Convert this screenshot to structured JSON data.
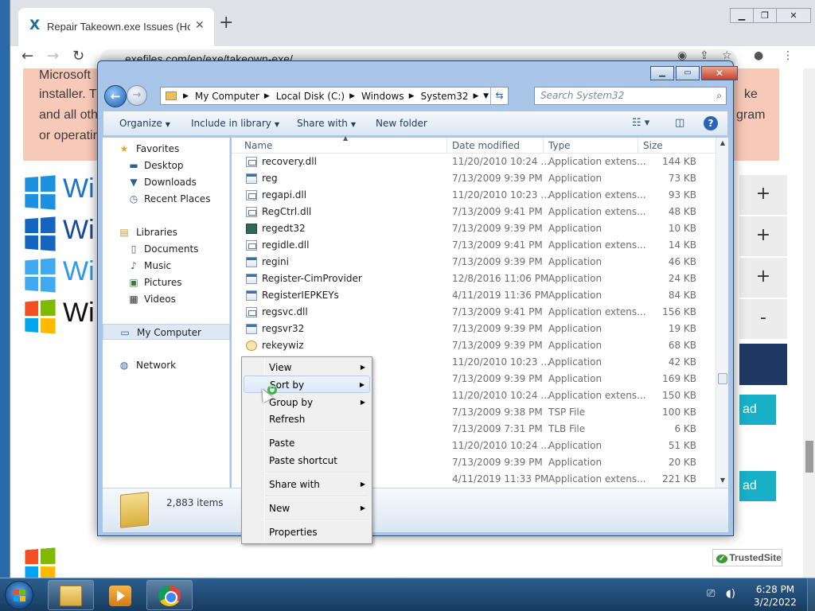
{
  "browser": {
    "tab_title": "Repair Takeown.exe Issues (How",
    "tab_close": "✕",
    "new_tab": "+",
    "url": "exefiles.com/en/exe/takeown-exe/",
    "page_lines": [
      "Microsoft",
      "installer. T",
      "and all oth",
      "or operatin"
    ],
    "right_lines": [
      "ke",
      "gram"
    ],
    "windows_label": "Wi",
    "accordion": [
      "+",
      "+",
      "+",
      "-"
    ],
    "download_label": "ad",
    "trusted_site": "TrustedSite"
  },
  "explorer": {
    "breadcrumb": [
      "My Computer",
      "Local Disk (C:)",
      "Windows",
      "System32"
    ],
    "search_placeholder": "Search System32",
    "commands": {
      "organize": "Organize",
      "include": "Include in library",
      "share": "Share with",
      "new_folder": "New folder"
    },
    "nav": {
      "favorites": "Favorites",
      "desktop": "Desktop",
      "downloads": "Downloads",
      "recent": "Recent Places",
      "libraries": "Libraries",
      "documents": "Documents",
      "music": "Music",
      "pictures": "Pictures",
      "videos": "Videos",
      "computer": "My Computer",
      "network": "Network"
    },
    "columns": [
      "Name",
      "Date modified",
      "Type",
      "Size"
    ],
    "files": [
      {
        "name": "recovery.dll",
        "date": "11/20/2010 10:24 ...",
        "type": "Application extens...",
        "size": "144 KB",
        "icon": "dll"
      },
      {
        "name": "reg",
        "date": "7/13/2009 9:39 PM",
        "type": "Application",
        "size": "73 KB",
        "icon": "app"
      },
      {
        "name": "regapi.dll",
        "date": "11/20/2010 10:23 ...",
        "type": "Application extens...",
        "size": "93 KB",
        "icon": "dll"
      },
      {
        "name": "RegCtrl.dll",
        "date": "7/13/2009 9:41 PM",
        "type": "Application extens...",
        "size": "48 KB",
        "icon": "dll"
      },
      {
        "name": "regedt32",
        "date": "7/13/2009 9:39 PM",
        "type": "Application",
        "size": "10 KB",
        "icon": "reged"
      },
      {
        "name": "regidle.dll",
        "date": "7/13/2009 9:41 PM",
        "type": "Application extens...",
        "size": "14 KB",
        "icon": "dll"
      },
      {
        "name": "regini",
        "date": "7/13/2009 9:39 PM",
        "type": "Application",
        "size": "46 KB",
        "icon": "app"
      },
      {
        "name": "Register-CimProvider",
        "date": "12/8/2016 11:06 PM",
        "type": "Application",
        "size": "24 KB",
        "icon": "app"
      },
      {
        "name": "RegisterIEPKEYs",
        "date": "4/11/2019 11:36 PM",
        "type": "Application",
        "size": "84 KB",
        "icon": "app"
      },
      {
        "name": "regsvc.dll",
        "date": "7/13/2009 9:41 PM",
        "type": "Application extens...",
        "size": "156 KB",
        "icon": "dll"
      },
      {
        "name": "regsvr32",
        "date": "7/13/2009 9:39 PM",
        "type": "Application",
        "size": "19 KB",
        "icon": "app"
      },
      {
        "name": "rekeywiz",
        "date": "7/13/2009 9:39 PM",
        "type": "Application",
        "size": "68 KB",
        "icon": "gear"
      },
      {
        "name": "",
        "date": "11/20/2010 10:23 ...",
        "type": "Application",
        "size": "42 KB",
        "icon": "dll"
      },
      {
        "name": "",
        "date": "7/13/2009 9:39 PM",
        "type": "Application",
        "size": "169 KB",
        "icon": "app"
      },
      {
        "name": "",
        "date": "11/20/2010 10:24 ...",
        "type": "Application extens...",
        "size": "150 KB",
        "icon": "dll"
      },
      {
        "name": "",
        "date": "7/13/2009 9:38 PM",
        "type": "TSP File",
        "size": "100 KB",
        "icon": "dll"
      },
      {
        "name": "",
        "date": "7/13/2009 7:31 PM",
        "type": "TLB File",
        "size": "6 KB",
        "icon": "dll"
      },
      {
        "name": "",
        "date": "11/20/2010 10:24 ...",
        "type": "Application",
        "size": "51 KB",
        "icon": "app"
      },
      {
        "name": "",
        "date": "7/13/2009 9:39 PM",
        "type": "Application",
        "size": "20 KB",
        "icon": "app"
      },
      {
        "name": "",
        "date": "4/11/2019 11:33 PM",
        "type": "Application extens...",
        "size": "221 KB",
        "icon": "dll"
      }
    ],
    "item_count": "2,883 items"
  },
  "context_menu": {
    "view": "View",
    "sort_by": "Sort by",
    "group_by": "Group by",
    "refresh": "Refresh",
    "paste": "Paste",
    "paste_shortcut": "Paste shortcut",
    "share_with": "Share with",
    "new": "New",
    "properties": "Properties"
  },
  "taskbar": {
    "time": "6:28 PM",
    "date": "3/2/2022"
  }
}
